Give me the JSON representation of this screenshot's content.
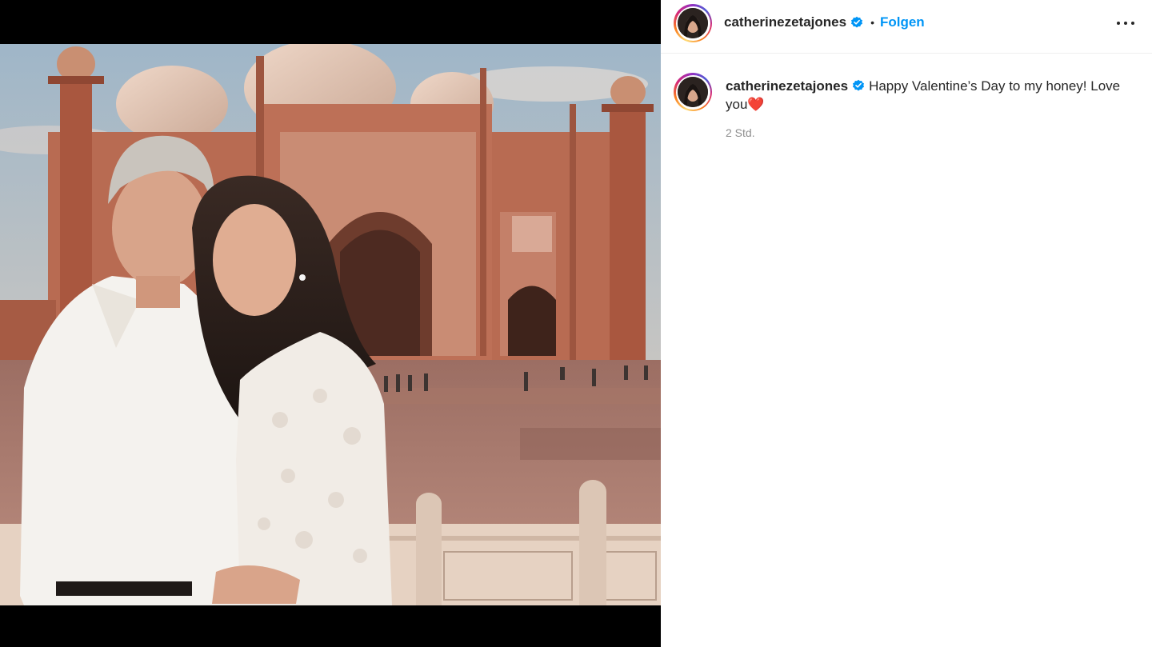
{
  "header": {
    "username": "catherinezetajones",
    "separator": "•",
    "follow_label": "Folgen",
    "more_icon": "more-horizontal-icon"
  },
  "caption": {
    "username": "catherinezetajones",
    "text": "Happy Valentine’s Day to my honey! Love you❤️",
    "timestamp": "2 Std."
  },
  "colors": {
    "accent": "#0095f6",
    "text": "#262626",
    "muted": "#8e8e8e",
    "divider": "#efefef"
  },
  "icons": {
    "verified": "verified-badge-icon"
  }
}
